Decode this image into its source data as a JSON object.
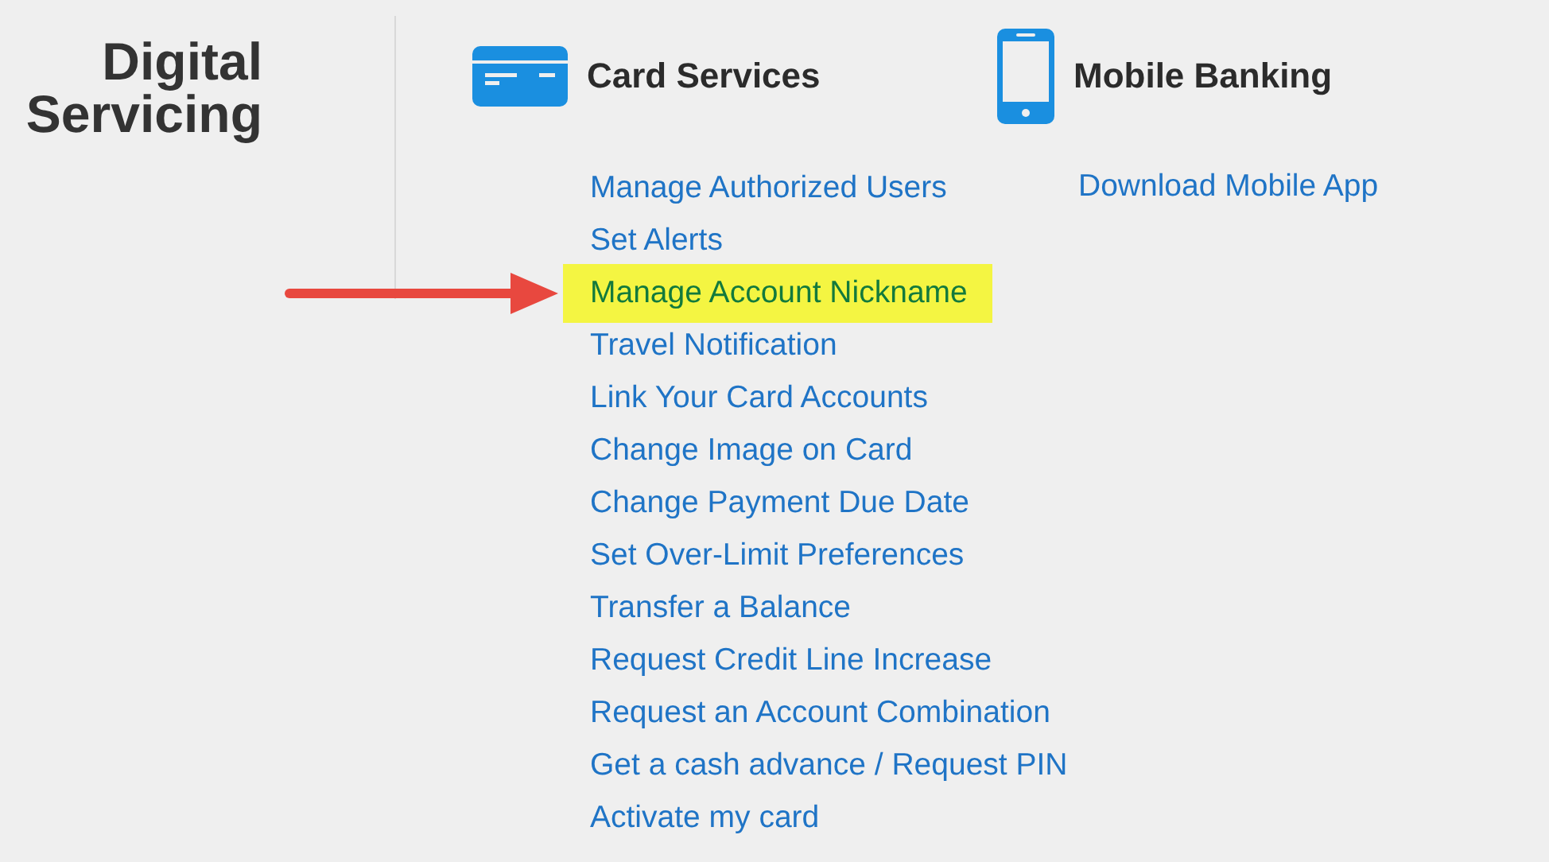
{
  "title": "Digital Servicing",
  "sections": [
    {
      "kind": "card",
      "heading": "Card Services",
      "links": [
        {
          "label": "Manage Authorized Users",
          "highlighted": false
        },
        {
          "label": "Set Alerts",
          "highlighted": false
        },
        {
          "label": "Manage Account Nickname",
          "highlighted": true
        },
        {
          "label": "Travel Notification",
          "highlighted": false
        },
        {
          "label": "Link Your Card Accounts",
          "highlighted": false
        },
        {
          "label": "Change Image on Card",
          "highlighted": false
        },
        {
          "label": "Change Payment Due Date",
          "highlighted": false
        },
        {
          "label": "Set Over-Limit Preferences",
          "highlighted": false
        },
        {
          "label": "Transfer a Balance",
          "highlighted": false
        },
        {
          "label": "Request Credit Line Increase",
          "highlighted": false
        },
        {
          "label": "Request an Account Combination",
          "highlighted": false
        },
        {
          "label": "Get a cash advance / Request PIN",
          "highlighted": false
        },
        {
          "label": "Activate my card",
          "highlighted": false
        }
      ]
    },
    {
      "kind": "mobile",
      "heading": "Mobile Banking",
      "links": [
        {
          "label": "Download Mobile App",
          "highlighted": false
        }
      ]
    }
  ]
}
